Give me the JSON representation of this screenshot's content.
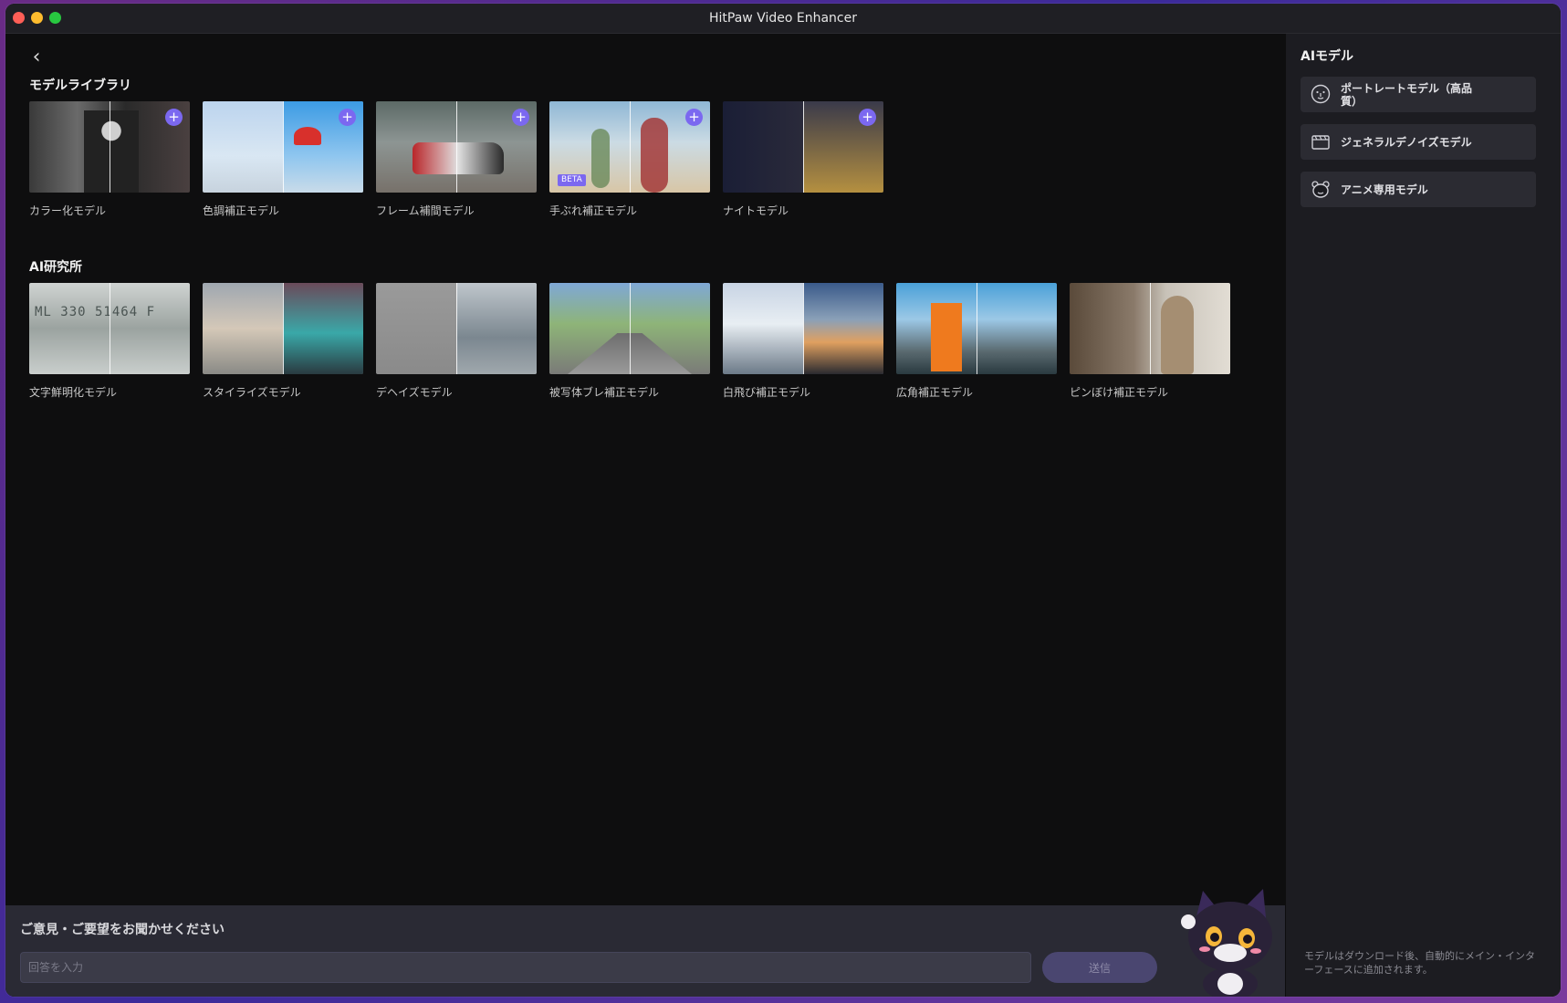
{
  "window": {
    "title": "HitPaw Video Enhancer"
  },
  "nav": {
    "back_glyph": "‹"
  },
  "model_library": {
    "title": "モデルライブラリ",
    "cards": [
      {
        "label": "カラー化モデル",
        "add_glyph": "+"
      },
      {
        "label": "色調補正モデル",
        "add_glyph": "+"
      },
      {
        "label": "フレーム補間モデル",
        "add_glyph": "+"
      },
      {
        "label": "手ぶれ補正モデル",
        "add_glyph": "+",
        "badge": "BETA"
      },
      {
        "label": "ナイトモデル",
        "add_glyph": "+"
      }
    ]
  },
  "ai_lab": {
    "title": "AI研究所",
    "cards": [
      {
        "label": "文字鮮明化モデル",
        "thumb_text": "ML 330 51464 F"
      },
      {
        "label": "スタイライズモデル"
      },
      {
        "label": "デヘイズモデル"
      },
      {
        "label": "被写体ブレ補正モデル"
      },
      {
        "label": "白飛び補正モデル"
      },
      {
        "label": "広角補正モデル"
      },
      {
        "label": "ピンぼけ補正モデル"
      }
    ]
  },
  "feedback": {
    "title": "ご意見・ご要望をお聞かせください",
    "placeholder": "回答を入力",
    "send_label": "送信"
  },
  "sidebar": {
    "title": "AIモデル",
    "models": [
      {
        "label": "ポートレートモデル（高品質）",
        "icon": "face-icon"
      },
      {
        "label": "ジェネラルデノイズモデル",
        "icon": "clapperboard-icon"
      },
      {
        "label": "アニメ専用モデル",
        "icon": "bear-icon"
      }
    ],
    "note": "モデルはダウンロード後、自動的にメイン・インターフェースに追加されます。"
  },
  "colors": {
    "accent": "#7b68f0",
    "background": "#0e0e0f",
    "sidebar_bg": "#1c1c21",
    "button_bg": "#2b2b32"
  }
}
